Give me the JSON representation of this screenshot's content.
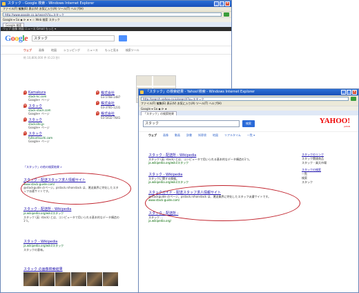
{
  "google_window": {
    "title": "スタック - Google 検索 - Windows Internet Explorer",
    "menu": "ファイル(F)  編集(E)  表示(V)  お気に入り(A)  ツール(T)  ヘルプ(H)",
    "address": "http://www.google.co.jp/search?q=スタック",
    "toolbar": "Google  ▾  Go  ◆  ⟳  ★  ▾  ☆  Web 検索  スタック",
    "tab": "Google 検索",
    "gbar": "ウェブ   画像   地図   ニュース   Gmail   もっと ▾",
    "logo": {
      "g1": "G",
      "o1": "o",
      "o2": "o",
      "g2": "g",
      "l": "l",
      "e": "e"
    },
    "query": "スタック",
    "tabs": [
      "ウェブ",
      "画像",
      "地図",
      "ショッピング",
      "ニュース",
      "もっと見る",
      "検索ツール"
    ],
    "stats": "約 10,800,000 件 (0.23 秒)",
    "locations": [
      {
        "pin": "A",
        "name": "Kamakura",
        "site": "stack-kc.com",
        "meta": "Google+ ページ"
      },
      {
        "pin": "B",
        "name": "スタック",
        "site": "stack-stock.com",
        "meta": "Google+ ページ"
      },
      {
        "pin": "C",
        "name": "スタック",
        "site": "stacksite.jp",
        "meta": "Google+ ページ"
      },
      {
        "pin": "D",
        "name": "スタック",
        "site": "fullsuntsuchi.com",
        "meta": "Google+ ページ"
      }
    ],
    "loc_right": [
      {
        "pin": "E",
        "name": "株式会社",
        "phone": "03-5768-1487"
      },
      {
        "pin": "F",
        "name": "株式会社",
        "phone": "03-3765-1231"
      },
      {
        "pin": "G",
        "name": "株式会社",
        "phone": "03-5432-7641"
      }
    ],
    "more": "「スタック」の他の検索結果 »",
    "results": [
      {
        "title": "スタック - 配送スタッフ求人情報サイト",
        "url": "www.stack-guide.com/",
        "snippet": "@stackguide のページ。pistack.nihonstack は、運送業界に特化したスタッフ派遣サイトです。"
      },
      {
        "title": "スタック - 配送所 - Wikipedia",
        "url": "ja.wikipedia.org/wiki/スタック",
        "snippet": "スタック (英: stack) とは、コンピュータで用いられる基本的なデータ構造の1つ。"
      },
      {
        "title": "スタック - Wikipedia",
        "url": "ja.wikipedia.org/wiki/スタック",
        "snippet": "スタックの意味。"
      }
    ],
    "images_heading": "スタック の画像検索結果"
  },
  "yahoo_window": {
    "title": "「スタック」の検索結果 - Yahoo!検索 - Windows Internet Explorer",
    "menu": "ファイル(F)  編集(E)  表示(V)  お気に入り(A)  ツール(T)  ヘルプ(H)",
    "address": "http://search.yahoo.co.jp/search?p=スタック",
    "toolbar": "Google  ▾  Go  ◆  ⟳  ★",
    "tab": "「スタック」の検索結果",
    "query": "スタック",
    "search_button": "検索",
    "logo": "YAHOO!",
    "logo_sub": "JAPAN",
    "tabs": [
      "ウェブ",
      "画像",
      "動画",
      "辞書",
      "知恵袋",
      "地図",
      "リアルタイム",
      "一覧 ▾"
    ],
    "results": [
      {
        "title": "スタック - 配送所 - Wikipedia",
        "url": "ja.wikipedia.org/wiki/スタック",
        "snippet": "スタック (英: stack) とは、コンピュータで用いられる基本的なデータ構造の1つ。"
      },
      {
        "title": "スタック - Wikipedia",
        "url": "ja.wikipedia.org/wiki/スタック",
        "snippet": "スタックに関する情報。"
      },
      {
        "title": "スタックガイド - 配送スタッフ求人情報サイト",
        "url": "www.stack-guide.com/",
        "snippet": "@stackguide のページ。pistack.nihonstack は、運送業界に特化したスタッフ派遣サイトです。"
      },
      {
        "title": "スタック - 配送所 -",
        "url": "ja.wikipedia.org/",
        "snippet": "スタック ..."
      }
    ],
    "side": [
      {
        "head": "スタックのリンク",
        "items": [
          "スタック関連商品",
          "スタック - 楽天市場"
        ]
      },
      {
        "head": "スタックの検索",
        "items": [
          "一覧",
          "検索",
          "スタック"
        ]
      }
    ]
  }
}
